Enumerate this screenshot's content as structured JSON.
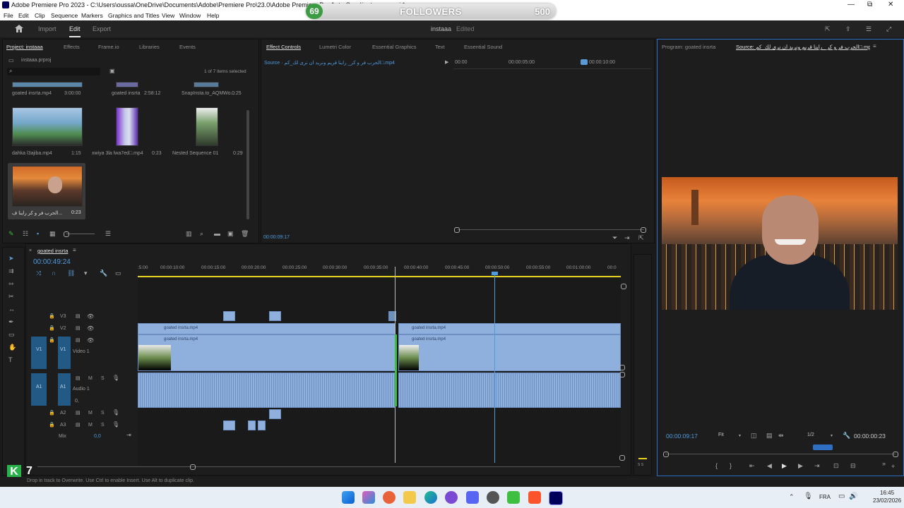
{
  "window": {
    "title": "Adobe Premiere Pro 2023 - C:\\Users\\oussa\\OneDrive\\Documents\\Adobe\\Premiere Pro\\23.0\\Adobe Premiere Pro Auto-Save\\instaaa.prproj *",
    "minimize": "—",
    "restore": "⧉",
    "close": "✕"
  },
  "overlay": {
    "count": "69",
    "label": "FOLLOWERS",
    "target": "500"
  },
  "menu": [
    "File",
    "Edit",
    "Clip",
    "Sequence",
    "Markers",
    "Graphics and Titles",
    "View",
    "Window",
    "Help"
  ],
  "header": {
    "tabs": [
      "Import",
      "Edit",
      "Export"
    ],
    "project": "instaaa",
    "status": "Edited"
  },
  "project_panel": {
    "tabs": [
      "Project: instaaa",
      "Effects",
      "Frame.io",
      "Libraries",
      "Events"
    ],
    "file": "instaaa.prproj",
    "selection_info": "1 of 7 items selected",
    "top_row": [
      {
        "name": "goated insrta.mp4",
        "duration": "3:00:00"
      },
      {
        "name": "goated insrta",
        "duration": "2:58:12"
      },
      {
        "name": "SnapInsta.to_AQMWo...",
        "duration": "0:25"
      }
    ],
    "items": [
      {
        "name": "dahka l3ajiba.mp4",
        "duration": "1:15"
      },
      {
        "name": "xwiya 3la lwa7ed□.mp4",
        "duration": "0:23"
      },
      {
        "name": "Nested Sequence 01",
        "duration": "0:29"
      }
    ],
    "selected_item": {
      "name": "الحرب فر و كر راينا ف...",
      "duration": "0:23"
    }
  },
  "effect_controls": {
    "tabs": [
      "Effect Controls",
      "Lumetri Color",
      "Essential Graphics",
      "Text",
      "Essential Sound"
    ],
    "source_label": "Source · الحرب فر و كر_ راينا قريم ونريد ان نرى لك_كم□.mp4",
    "ruler": [
      "00:00",
      "00:00:05:00",
      "00:00:10:00"
    ],
    "timecode": "00:00:09:17"
  },
  "program_monitor": {
    "tabs": [
      "Program: goated insrta",
      "Source: الحرب فر و كر_ راينا قريم ونريد ان نرى لك_كم□.mp4"
    ],
    "timecode": "00:00:09:17",
    "fit": "Fit",
    "fraction": "1/2",
    "duration": "00:00:00:23"
  },
  "timeline": {
    "sequence": "goated insrta",
    "timecode": "00:00:49:24",
    "ruler": [
      ":5:00",
      "00:00:10:00",
      "00:00:15:00",
      "00:00:20:00",
      "00:00:25:00",
      "00:00:30:00",
      "00:00:35:00",
      "00:00:40:00",
      "00:00:45:00",
      "00:00:50:00",
      "00:00:55:00",
      "00:01:00:00",
      "00:0"
    ],
    "tracks": {
      "v3": "V3",
      "v2": "V2",
      "v1": "V1",
      "v1_src": "V1",
      "video1": "Video 1",
      "a1": "A1",
      "a1_src": "A1",
      "audio1": "Audio 1",
      "a2": "A2",
      "a3": "A3",
      "mix": "Mix",
      "mix_value": "0,0",
      "mute": "M",
      "solo": "S",
      "vol": "0,"
    },
    "clips": [
      "goated insrta.mp4",
      "goated insrta.mp4",
      "goated insrta.mp4",
      "goated insrta.mp4"
    ],
    "meter": "S S"
  },
  "status_bar": "Drop in track to Overwrite. Use Ctrl to enable Insert. Use Alt to duplicate clip.",
  "overlay_corner": "7",
  "taskbar": {
    "lang": "FRA",
    "time": "16:45",
    "date": "23/02/2026"
  }
}
